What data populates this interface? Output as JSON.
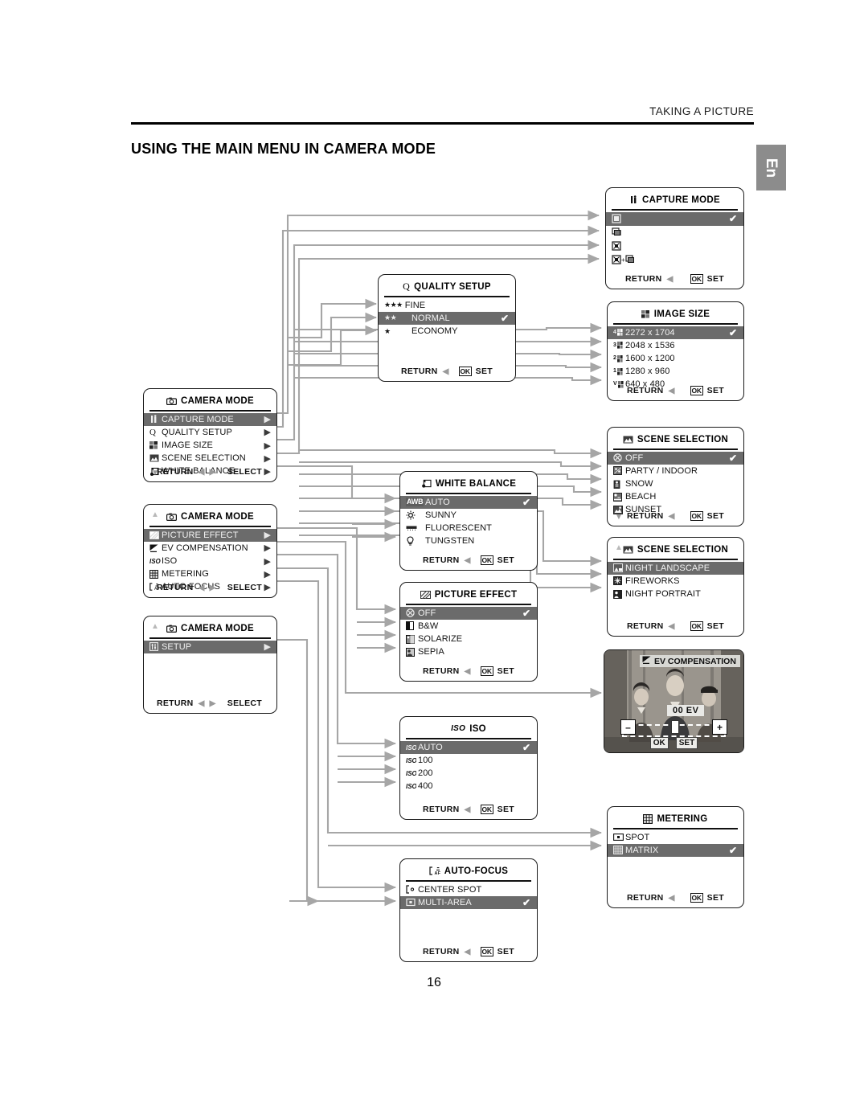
{
  "header": {
    "running_head": "TAKING A PICTURE",
    "title": "USING THE MAIN MENU IN CAMERA MODE",
    "lang_tab": "En"
  },
  "page_number": "16",
  "common": {
    "return_label": "RETURN",
    "select_label": "SELECT",
    "set_label": "SET",
    "ok_label": "OK",
    "left_arrow": "◀",
    "right_arrow": "▶",
    "up_arrow": "▲",
    "down_arrow": "▼",
    "check": "✔"
  },
  "panels": {
    "camera_mode_1": {
      "title": "CAMERA MODE",
      "title_icon": "camera-icon",
      "items": [
        {
          "label": "CAPTURE MODE",
          "icon": "capture-mode-icon",
          "selected": true,
          "chevron": "▶"
        },
        {
          "label": "QUALITY SETUP",
          "icon": "quality-q-icon",
          "selected": false,
          "chevron": "▶"
        },
        {
          "label": "IMAGE SIZE",
          "icon": "image-size-icon",
          "selected": false,
          "chevron": "▶"
        },
        {
          "label": "SCENE SELECTION",
          "icon": "scene-selection-icon",
          "selected": false,
          "chevron": "▶"
        },
        {
          "label": "WHITE BALANCE",
          "icon": "white-balance-icon",
          "selected": false,
          "chevron": "▶"
        }
      ],
      "footer": {
        "left": "RETURN",
        "right": "SELECT",
        "has_down_arrow": true
      }
    },
    "camera_mode_2": {
      "title": "CAMERA MODE",
      "title_icon": "camera-icon",
      "has_up_arrow": true,
      "items": [
        {
          "label": "PICTURE EFFECT",
          "icon": "picture-effect-icon",
          "selected": true,
          "chevron": "▶"
        },
        {
          "label": "EV COMPENSATION",
          "icon": "ev-compensation-icon",
          "selected": false,
          "chevron": "▶"
        },
        {
          "label": "ISO",
          "icon": "iso-icon",
          "selected": false,
          "chevron": "▶"
        },
        {
          "label": "METERING",
          "icon": "metering-icon",
          "selected": false,
          "chevron": "▶"
        },
        {
          "label": "AUTO FOCUS",
          "icon": "auto-focus-icon",
          "selected": false,
          "chevron": "▶"
        }
      ],
      "footer": {
        "left": "RETURN",
        "right": "SELECT"
      }
    },
    "camera_mode_3": {
      "title": "CAMERA MODE",
      "title_icon": "camera-icon",
      "has_up_arrow": true,
      "items": [
        {
          "label": "SETUP",
          "icon": "setup-icon",
          "selected": true,
          "chevron": "▶"
        }
      ],
      "footer": {
        "left": "RETURN",
        "right": "SELECT"
      }
    },
    "quality_setup": {
      "title": "QUALITY SETUP",
      "title_icon": "quality-q-icon",
      "items": [
        {
          "label": "FINE",
          "stars": "★★★",
          "selected": false,
          "checked": false
        },
        {
          "label": "NORMAL",
          "stars": "★★",
          "selected": true,
          "checked": true
        },
        {
          "label": "ECONOMY",
          "stars": "★",
          "selected": false,
          "checked": false
        }
      ],
      "footer": {
        "left": "RETURN",
        "ok": "OK",
        "right": "SET"
      }
    },
    "capture_mode": {
      "title": "CAPTURE MODE",
      "title_icon": "capture-mode-icon",
      "items": [
        {
          "label": "",
          "icon": "single-frame-icon",
          "selected": true,
          "checked": true
        },
        {
          "label": "",
          "icon": "continuous-icon",
          "selected": false,
          "checked": false
        },
        {
          "label": "",
          "icon": "auto-bracket-icon",
          "selected": false,
          "checked": false
        },
        {
          "label": "",
          "icon": "bracket-continuous-icon",
          "selected": false,
          "checked": false
        }
      ],
      "footer": {
        "left": "RETURN",
        "ok": "OK",
        "right": "SET"
      }
    },
    "image_size": {
      "title": "IMAGE SIZE",
      "title_icon": "image-size-icon",
      "items": [
        {
          "label": "2272 x 1704",
          "badge": "4",
          "selected": true,
          "checked": true
        },
        {
          "label": "2048 x 1536",
          "badge": "3",
          "selected": false,
          "checked": false
        },
        {
          "label": "1600 x 1200",
          "badge": "2",
          "selected": false,
          "checked": false
        },
        {
          "label": "1280 x 960",
          "badge": "1",
          "selected": false,
          "checked": false
        },
        {
          "label": "640 x 480",
          "badge": "V",
          "selected": false,
          "checked": false
        }
      ],
      "footer": {
        "left": "RETURN",
        "ok": "OK",
        "right": "SET"
      }
    },
    "scene_selection_1": {
      "title": "SCENE SELECTION",
      "title_icon": "scene-selection-icon",
      "items": [
        {
          "label": "OFF",
          "icon": "off-circle-icon",
          "selected": true,
          "checked": true
        },
        {
          "label": "PARTY / INDOOR",
          "icon": "party-indoor-icon",
          "selected": false,
          "checked": false
        },
        {
          "label": "SNOW",
          "icon": "snow-icon",
          "selected": false,
          "checked": false
        },
        {
          "label": "BEACH",
          "icon": "beach-icon",
          "selected": false,
          "checked": false
        },
        {
          "label": "SUNSET",
          "icon": "sunset-icon",
          "selected": false,
          "checked": false
        }
      ],
      "footer": {
        "left": "RETURN",
        "ok": "OK",
        "right": "SET",
        "has_down_arrow": true
      }
    },
    "scene_selection_2": {
      "title": "SCENE SELECTION",
      "title_icon": "scene-selection-icon",
      "has_up_arrow": true,
      "items": [
        {
          "label": "NIGHT LANDSCAPE",
          "icon": "night-landscape-icon",
          "selected": true,
          "checked": false
        },
        {
          "label": "FIREWORKS",
          "icon": "fireworks-icon",
          "selected": false,
          "checked": false
        },
        {
          "label": "NIGHT PORTRAIT",
          "icon": "night-portrait-icon",
          "selected": false,
          "checked": false
        }
      ],
      "footer": {
        "left": "RETURN",
        "ok": "OK",
        "right": "SET"
      }
    },
    "white_balance": {
      "title": "WHITE BALANCE",
      "title_icon": "white-balance-icon",
      "items": [
        {
          "label": "AUTO",
          "icon": "awb-icon",
          "selected": true,
          "checked": true
        },
        {
          "label": "SUNNY",
          "icon": "sunny-icon",
          "selected": false,
          "checked": false
        },
        {
          "label": "FLUORESCENT",
          "icon": "fluorescent-icon",
          "selected": false,
          "checked": false
        },
        {
          "label": "TUNGSTEN",
          "icon": "tungsten-icon",
          "selected": false,
          "checked": false
        }
      ],
      "footer": {
        "left": "RETURN",
        "ok": "OK",
        "right": "SET"
      }
    },
    "picture_effect": {
      "title": "PICTURE EFFECT",
      "title_icon": "picture-effect-icon",
      "items": [
        {
          "label": "OFF",
          "icon": "off-circle-icon",
          "selected": true,
          "checked": true
        },
        {
          "label": "B&W",
          "icon": "bw-icon",
          "selected": false,
          "checked": false
        },
        {
          "label": "SOLARIZE",
          "icon": "solarize-icon",
          "selected": false,
          "checked": false
        },
        {
          "label": "SEPIA",
          "icon": "sepia-icon",
          "selected": false,
          "checked": false
        }
      ],
      "footer": {
        "left": "RETURN",
        "ok": "OK",
        "right": "SET"
      }
    },
    "iso": {
      "title": "ISO",
      "title_icon": "iso-icon",
      "items": [
        {
          "label": "AUTO",
          "icon": "iso-auto-icon",
          "selected": true,
          "checked": true
        },
        {
          "label": "100",
          "icon": "iso-100-icon",
          "selected": false,
          "checked": false
        },
        {
          "label": "200",
          "icon": "iso-200-icon",
          "selected": false,
          "checked": false
        },
        {
          "label": "400",
          "icon": "iso-400-icon",
          "selected": false,
          "checked": false
        }
      ],
      "footer": {
        "left": "RETURN",
        "ok": "OK",
        "right": "SET"
      }
    },
    "auto_focus": {
      "title": "AUTO-FOCUS",
      "title_icon": "auto-focus-icon",
      "items": [
        {
          "label": "CENTER SPOT",
          "icon": "center-spot-icon",
          "selected": false,
          "checked": false
        },
        {
          "label": "MULTI-AREA",
          "icon": "multi-area-icon",
          "selected": true,
          "checked": true
        }
      ],
      "footer": {
        "left": "RETURN",
        "ok": "OK",
        "right": "SET"
      }
    },
    "metering": {
      "title": "METERING",
      "title_icon": "metering-icon",
      "items": [
        {
          "label": "SPOT",
          "icon": "spot-metering-icon",
          "selected": false,
          "checked": false
        },
        {
          "label": "MATRIX",
          "icon": "matrix-metering-icon",
          "selected": true,
          "checked": true
        }
      ],
      "footer": {
        "left": "RETURN",
        "ok": "OK",
        "right": "SET"
      }
    },
    "ev_compensation": {
      "title": "EV COMPENSATION",
      "title_icon": "ev-compensation-icon",
      "value": "00  EV",
      "minus": "–",
      "plus": "+",
      "ok": "OK",
      "set": "SET"
    }
  }
}
